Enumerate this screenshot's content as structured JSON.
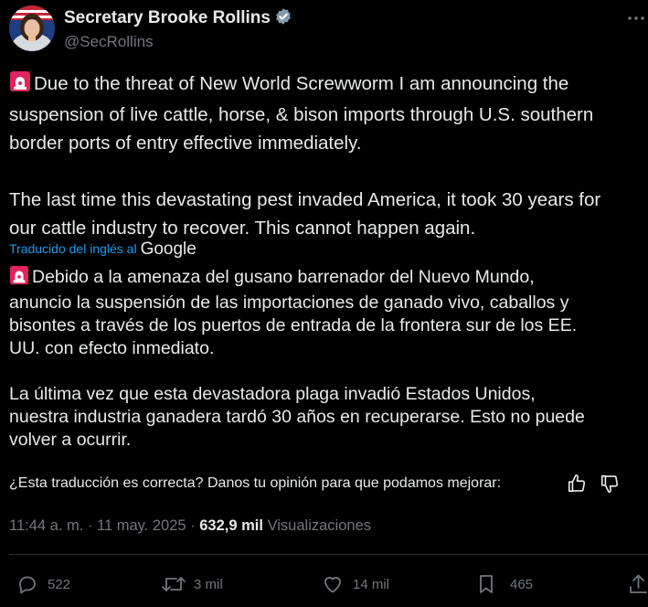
{
  "author": {
    "name": "Secretary Brooke Rollins",
    "handle": "@SecRollins",
    "verified_badge_icon": "verified-badge-icon",
    "badge_color": "#829aab"
  },
  "tweet": {
    "english_lines": [
      "Due to the threat of New World Screwworm I am announcing the",
      "suspension of live cattle, horse, & bison imports through U.S. southern",
      "border ports of entry effective immediately.",
      "The last time this devastating pest invaded America, it took 30 years for",
      "our cattle industry to recover. This cannot happen again."
    ],
    "translation_label": "Traducido del inglés al",
    "translation_provider": "Google",
    "spanish_lines": [
      "Debido a la amenaza del gusano barrenador del Nuevo Mundo,",
      "anuncio la suspensión de las importaciones de ganado vivo, caballos y",
      "bisontes a través de los puertos de entrada de la frontera sur de los EE.",
      "UU. con efecto inmediato.",
      "La última vez que esta devastadora plaga invadió Estados Unidos,",
      "nuestra industria ganadera tardó 30 años en recuperarse. Esto no puede",
      "volver a ocurrir."
    ]
  },
  "feedback": {
    "question": "¿Esta traducción es correcta? Danos tu opinión para que podamos mejorar:"
  },
  "meta": {
    "time": "11:44 a. m.",
    "date": "11 may. 2025",
    "separator": "·",
    "views_count": "632,9 mil",
    "views_label": "Visualizaciones"
  },
  "actions": {
    "replies": "522",
    "reposts": "3 mil",
    "likes": "14 mil",
    "bookmarks": "465"
  },
  "colors": {
    "background": "#000000",
    "text": "#e7e9ea",
    "secondary": "#71767b",
    "link": "#1d9bf0",
    "siren": "#e0245e"
  }
}
